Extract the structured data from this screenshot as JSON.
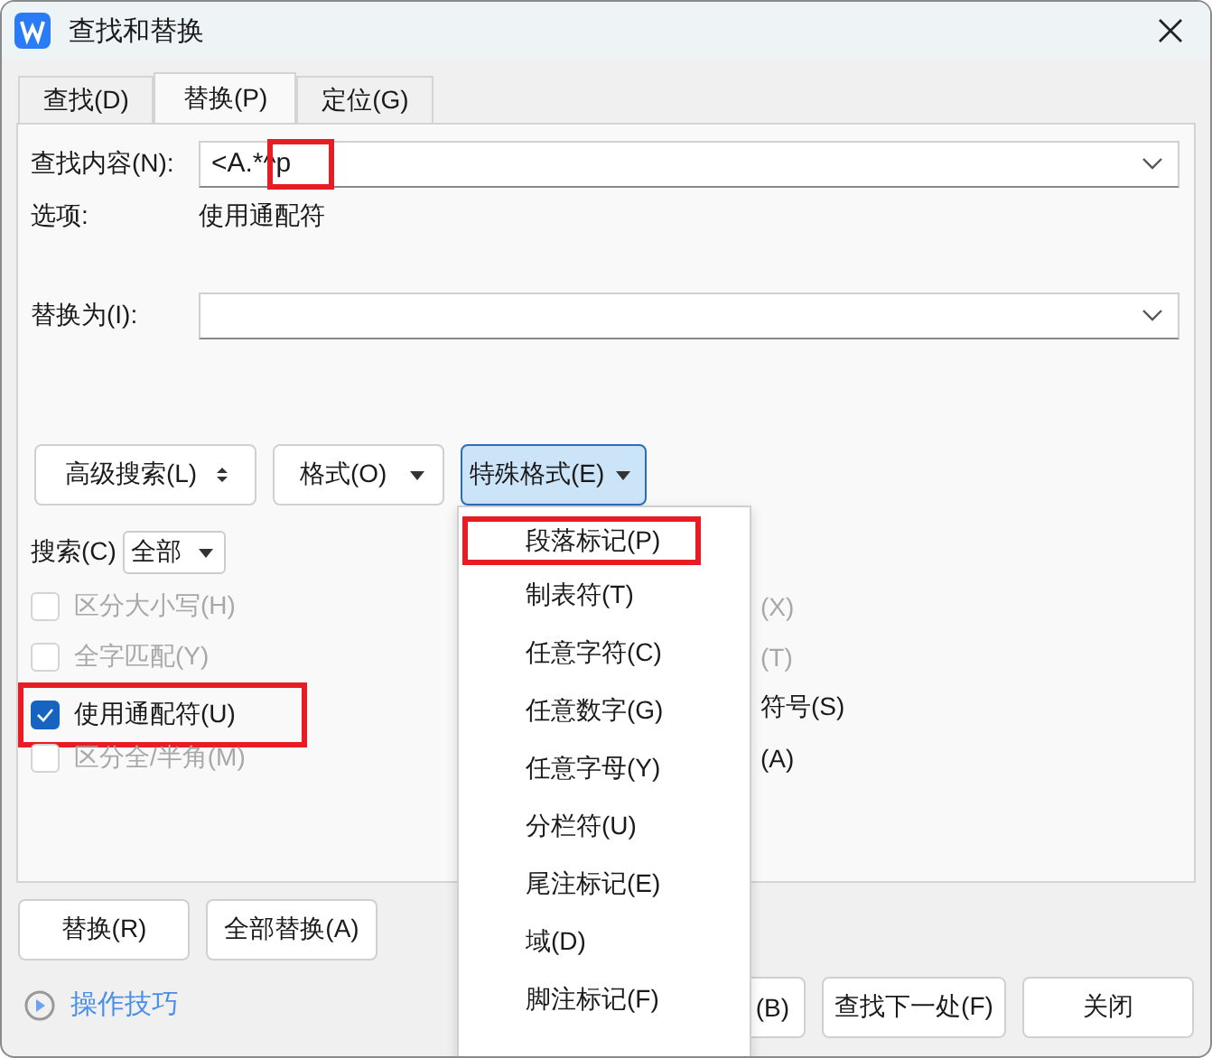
{
  "window": {
    "title": "查找和替换"
  },
  "tabs": [
    {
      "label": "查找(D)",
      "selected": false
    },
    {
      "label": "替换(P)",
      "selected": true
    },
    {
      "label": "定位(G)",
      "selected": false
    }
  ],
  "find": {
    "label": "查找内容(N):",
    "value": "<A.*^p",
    "marked": true
  },
  "options": {
    "label": "选项:",
    "value": "使用通配符"
  },
  "replace": {
    "label": "替换为(I):"
  },
  "buttons": [
    {
      "label": "高级搜索(L)",
      "kind": "updown",
      "active": false
    },
    {
      "label": "格式(O)",
      "kind": "dropdown",
      "active": false
    },
    {
      "label": "特殊格式(E)",
      "kind": "dropdown",
      "active": true
    }
  ],
  "search": {
    "label": "搜索(C)",
    "value": "全部"
  },
  "checkboxes_left": [
    {
      "label": "区分大小写(H)",
      "checked": false,
      "disabled": true,
      "marked": false
    },
    {
      "label": "全字匹配(Y)",
      "checked": false,
      "disabled": true,
      "marked": false
    },
    {
      "label": "使用通配符(U)",
      "checked": true,
      "disabled": false,
      "marked": true
    },
    {
      "label": "区分全/半角(M)",
      "checked": false,
      "disabled": true,
      "marked": false
    }
  ],
  "checkboxes_right": [
    {
      "label": "(X)",
      "disabled": true
    },
    {
      "label": "(T)",
      "disabled": true
    },
    {
      "label": "符号(S)",
      "disabled": false
    },
    {
      "label": "(A)",
      "disabled": false
    }
  ],
  "action_buttons": [
    "替换(R)",
    "全部替换(A)"
  ],
  "tips": "操作技巧",
  "footer_buttons": [
    "(B)",
    "查找下一处(F)",
    "关闭"
  ],
  "menu": {
    "items": [
      {
        "label": "段落标记(P)",
        "marked": true
      },
      {
        "label": "制表符(T)",
        "marked": false
      },
      {
        "label": "任意字符(C)",
        "marked": false
      },
      {
        "label": "任意数字(G)",
        "marked": false
      },
      {
        "label": "任意字母(Y)",
        "marked": false
      },
      {
        "label": "分栏符(U)",
        "marked": false
      },
      {
        "label": "尾注标记(E)",
        "marked": false
      },
      {
        "label": "域(D)",
        "marked": false
      },
      {
        "label": "脚注标记(F)",
        "marked": false
      }
    ]
  }
}
